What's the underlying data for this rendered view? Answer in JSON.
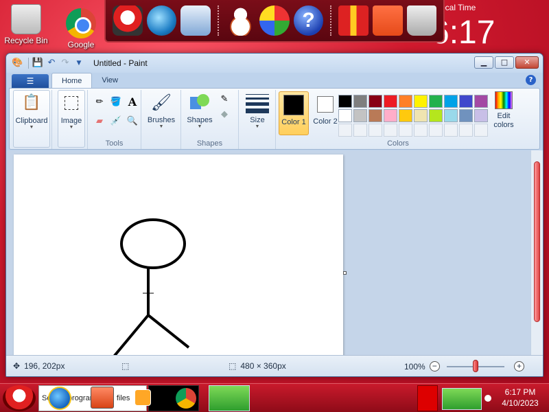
{
  "desktop": {
    "icons": [
      {
        "label": "Recycle Bin",
        "icon": "recycle-bin-icon"
      },
      {
        "label": "Google",
        "icon": "google-chrome-icon"
      }
    ],
    "clock_label": "ocal Time",
    "clock_big": "6:17"
  },
  "window": {
    "title": "Untitled - Paint",
    "minimize": "▁",
    "maximize": "□",
    "close": "✕"
  },
  "tabs": [
    {
      "label": "Home",
      "active": true
    },
    {
      "label": "View",
      "active": false
    }
  ],
  "ribbon": {
    "clipboard": "Clipboard",
    "image": "Image",
    "tools_group": "Tools",
    "brushes": "Brushes",
    "shapes": "Shapes",
    "shapes_group": "Shapes",
    "size": "Size",
    "color1": "Color 1",
    "color2": "Color 2",
    "edit_colors": "Edit colors",
    "colors_group": "Colors"
  },
  "colors": {
    "color1": "#000000",
    "color2": "#ffffff",
    "palette_row1": [
      "#000000",
      "#7f7f7f",
      "#880015",
      "#ed1c24",
      "#ff7f27",
      "#fff200",
      "#22b14c",
      "#00a2e8",
      "#3f48cc",
      "#a349a4"
    ],
    "palette_row2": [
      "#ffffff",
      "#c3c3c3",
      "#b97a57",
      "#ffaec9",
      "#ffc90e",
      "#efe4b0",
      "#b5e61d",
      "#99d9ea",
      "#7092be",
      "#c8bfe7"
    ],
    "accent": "#e04545"
  },
  "status": {
    "cursor_pos": "196, 202px",
    "canvas_size": "480 × 360px",
    "zoom": "100%",
    "zoom_level": 0.5
  },
  "taskbar": {
    "search_text": "Search programs and files",
    "time": "6:17 PM",
    "date": "4/10/2023"
  }
}
